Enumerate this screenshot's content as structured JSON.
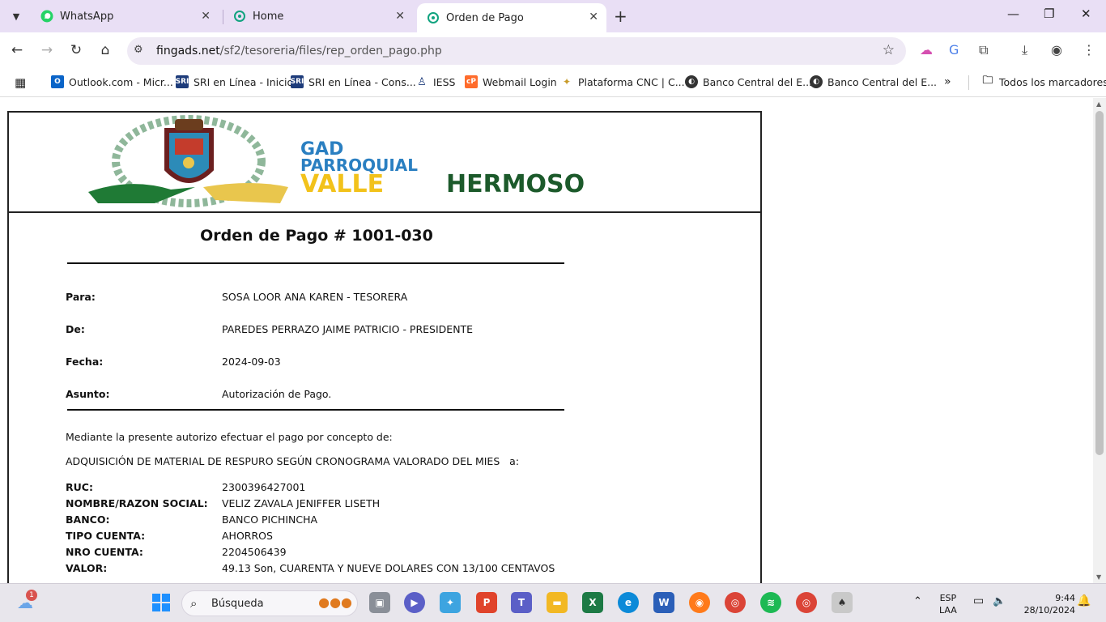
{
  "browser": {
    "tabs": [
      {
        "label": "WhatsApp",
        "active": false
      },
      {
        "label": "Home",
        "active": false
      },
      {
        "label": "Orden de Pago",
        "active": true
      }
    ],
    "url_domain": "fingads.net",
    "url_path": "/sf2/tesoreria/files/rep_orden_pago.php",
    "bookmarks": [
      {
        "label": "Outlook.com - Micr..."
      },
      {
        "label": "SRI en Línea - Inicio"
      },
      {
        "label": "SRI en Línea - Cons..."
      },
      {
        "label": "IESS"
      },
      {
        "label": "Webmail Login"
      },
      {
        "label": "Plataforma CNC | C..."
      },
      {
        "label": "Banco Central del E..."
      },
      {
        "label": "Banco Central del E..."
      }
    ],
    "all_bookmarks": "Todos los marcadores"
  },
  "logo": {
    "line1": "GAD",
    "line2": "PARROQUIAL",
    "line3a": "VALLE",
    "line3b": "HERMOSO",
    "colors": {
      "green": "#1f8a3c",
      "blue": "#2a7fc1",
      "yellow": "#f2c21b",
      "dark_green": "#1c5a2b"
    }
  },
  "document": {
    "title": "Orden de Pago # 1001-030",
    "para_label": "Para:",
    "para_value": "SOSA LOOR ANA KAREN - TESORERA",
    "de_label": "De:",
    "de_value": "PAREDES PERRAZO JAIME PATRICIO - PRESIDENTE",
    "fecha_label": "Fecha:",
    "fecha_value": "2024-09-03",
    "asunto_label": "Asunto:",
    "asunto_value": "Autorización de Pago.",
    "intro": "Mediante la presente autorizo efectuar el pago por concepto de:",
    "concepto": "ADQUISICIÓN DE MATERIAL DE RESPURO SEGÚN CRONOGRAMA VALORADO DEL MIES   a:",
    "ruc_label": "RUC:",
    "ruc_value": "2300396427001",
    "nombre_label": "NOMBRE/RAZON SOCIAL:",
    "nombre_value": "VELIZ ZAVALA JENIFFER LISETH",
    "banco_label": "BANCO:",
    "banco_value": "BANCO PICHINCHA",
    "tipo_label": "TIPO CUENTA:",
    "tipo_value": "AHORROS",
    "nro_label": "NRO CUENTA:",
    "nro_value": "2204506439",
    "valor_label": "VALOR:",
    "valor_value": "49.13 Son, CUARENTA Y NUEVE DOLARES CON 13/100 CENTAVOS"
  },
  "taskbar": {
    "weather_badge": "1",
    "search_placeholder": "Búsqueda",
    "lang": "ESP",
    "layout": "LAA",
    "time": "9:44",
    "date": "28/10/2024"
  }
}
